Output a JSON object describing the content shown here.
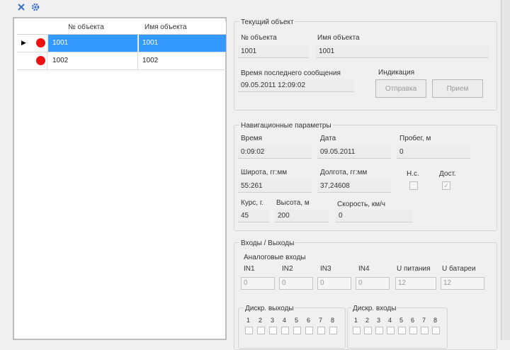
{
  "toolbar": {
    "icons": [
      "close-x-icon",
      "settings-gear-icon"
    ]
  },
  "grid": {
    "columns": [
      "№ объекта",
      "Имя объекта"
    ],
    "rows": [
      {
        "number": "1001",
        "name": "1001",
        "status": "red",
        "selected": true,
        "current": true
      },
      {
        "number": "1002",
        "name": "1002",
        "status": "red",
        "selected": false,
        "current": false
      }
    ]
  },
  "current": {
    "title": "Текущий объект",
    "num_label": "№ объекта",
    "num_value": "1001",
    "name_label": "Имя объекта",
    "name_value": "1001",
    "last_msg_label": "Время последнего сообщения",
    "last_msg_value": "09.05.2011 12:09:02",
    "indication_label": "Индикация",
    "send_button": "Отправка",
    "recv_button": "Прием"
  },
  "nav": {
    "title": "Навигационные параметры",
    "time_label": "Время",
    "time_value": "0:09:02",
    "date_label": "Дата",
    "date_value": "09.05.2011",
    "mileage_label": "Пробег, м",
    "mileage_value": "0",
    "lat_label": "Широта, гг:мм",
    "lat_value": "55:261",
    "lon_label": "Долгота, гг:мм",
    "lon_value": "37,24608",
    "valid_label": "Н.с.",
    "checked_label": "Дост.",
    "course_label": "Курс, г.",
    "course_value": "45",
    "alt_label": "Высота, м",
    "alt_value": "200",
    "speed_label": "Скорость, км/ч",
    "speed_value": "0"
  },
  "io": {
    "title": "Входы / Выходы",
    "analog_title": "Аналоговые входы",
    "analog": [
      {
        "label": "IN1",
        "value": "0"
      },
      {
        "label": "IN2",
        "value": "0"
      },
      {
        "label": "IN3",
        "value": "0"
      },
      {
        "label": "IN4",
        "value": "0"
      },
      {
        "label": "U питания",
        "value": "12"
      },
      {
        "label": "U батареи",
        "value": "12"
      }
    ],
    "dout_title": "Дискр. выходы",
    "dout_bits": [
      "1",
      "2",
      "3",
      "4",
      "5",
      "6",
      "7",
      "8"
    ],
    "din_title": "Дискр. входы",
    "din_bits": [
      "1",
      "2",
      "3",
      "4",
      "5",
      "6",
      "7",
      "8"
    ]
  }
}
